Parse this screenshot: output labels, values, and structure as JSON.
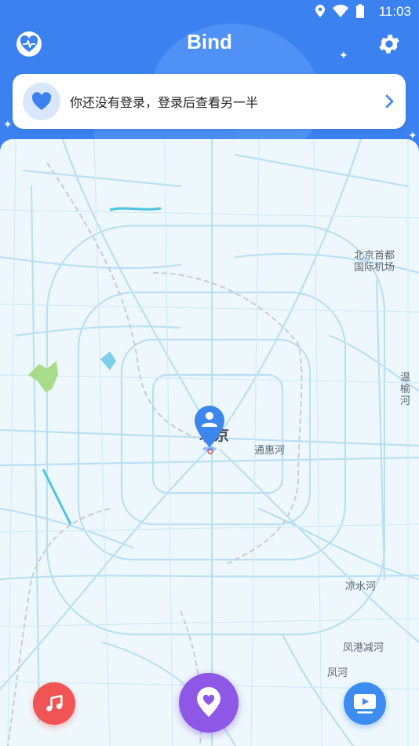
{
  "status_bar": {
    "time": "11:03"
  },
  "header": {
    "title": "Bind"
  },
  "login_banner": {
    "text": "你还没有登录，登录后查看另一半"
  },
  "map": {
    "labels": {
      "airport": "北京首都国际机场",
      "city": "北京",
      "tonghui": "通惠河",
      "wenyu": "温榆河",
      "liangshui": "凉水河",
      "fenggang": "凤港减河",
      "fenghe": "凤河"
    }
  },
  "nav": {
    "music_icon": "music-note-icon",
    "center_icon": "location-heart-icon",
    "video_icon": "video-screen-icon"
  },
  "colors": {
    "primary": "#3b82f0",
    "music": "#f15454",
    "center": "#8e57e6",
    "video": "#3d8cf0",
    "road": "#b9e0f3"
  }
}
